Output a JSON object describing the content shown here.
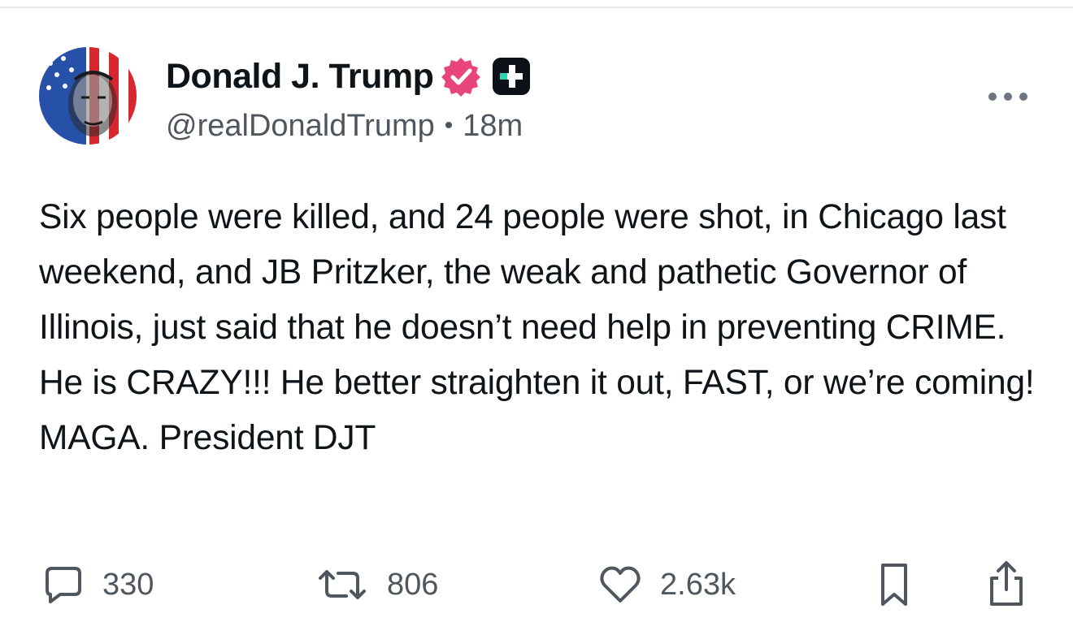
{
  "post": {
    "author": {
      "display_name": "Donald J. Trump",
      "handle": "@realDonaldTrump",
      "verified_icon": "verified-badge-icon",
      "membership_icon": "plus-badge-icon"
    },
    "separator": "•",
    "time_ago": "18m",
    "text": "Six people were killed, and 24 people were shot, in Chicago last weekend, and JB Pritzker, the weak and pathetic Governor of Illinois, just said that he doesn’t need help in preventing CRIME. He is CRAZY!!! He better straighten it out, FAST, or we’re coming! MAGA. President DJT",
    "actions": {
      "replies": "330",
      "retruths": "806",
      "likes": "2.63k"
    }
  },
  "colors": {
    "text": "#0f1419",
    "muted": "#50565e",
    "verified_badge": "#e8467a",
    "plus_badge": "#0d1117",
    "plus_accent": "#2ad4b4"
  },
  "icons": [
    "more-icon",
    "reply-icon",
    "retruth-icon",
    "like-icon",
    "bookmark-icon",
    "share-icon"
  ]
}
